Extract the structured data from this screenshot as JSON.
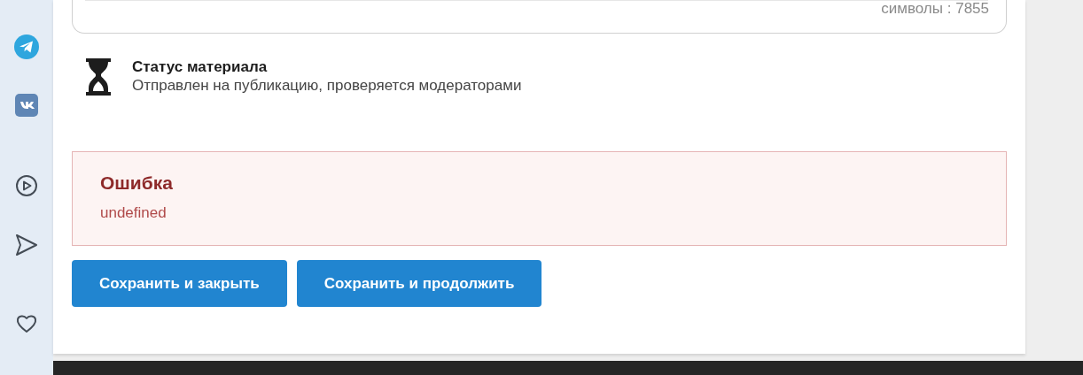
{
  "editor": {
    "counter": "символы : 7855"
  },
  "status": {
    "title": "Статус материала",
    "text": "Отправлен на публикацию, проверяется модераторами"
  },
  "alert": {
    "title": "Ошибка",
    "text": "undefined"
  },
  "buttons": [
    "Сохранить и закрыть",
    "Сохранить и продолжить"
  ]
}
